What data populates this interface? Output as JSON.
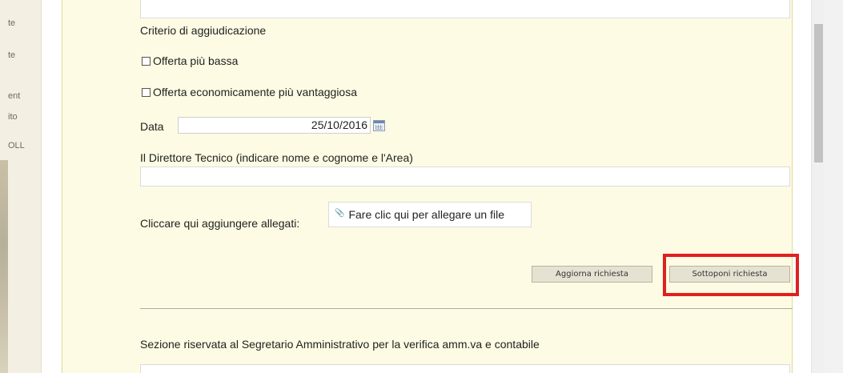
{
  "sidebar_fragments": [
    "te",
    "te",
    "ent",
    "ito",
    "OLL"
  ],
  "form": {
    "criterio_label": "Criterio di aggiudicazione",
    "option_1": "Offerta più bassa",
    "option_2": "Offerta economicamente più vantaggiosa",
    "data_label": "Data",
    "data_value": "25/10/2016",
    "direttore_label": "Il Direttore Tecnico (indicare nome e cognome e l'Area)",
    "allegati_label": "Cliccare qui aggiungere allegati:",
    "attach_text": "Fare clic qui per allegare un file",
    "update_button": "Aggiorna richiesta",
    "submit_button": "Sottoponi richiesta",
    "section_label": "Sezione riservata al Segretario Amministrativo per la verifica amm.va e contabile"
  },
  "colors": {
    "form_bg": "#fdfbe3",
    "button_bg": "#e6e2d2",
    "highlight": "#e02020"
  },
  "icons": [
    "calendar-icon",
    "paperclip-icon"
  ]
}
